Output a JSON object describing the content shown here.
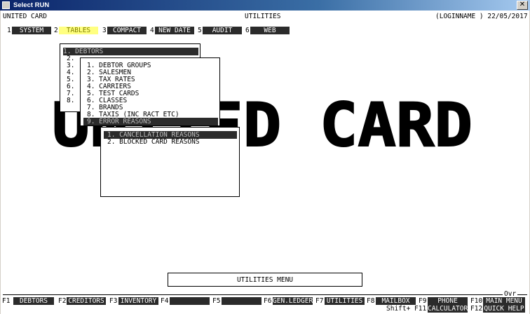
{
  "window": {
    "title": "Select RUN",
    "close_glyph": "✕"
  },
  "header": {
    "left": "UNITED CARD",
    "center": "UTILITIES",
    "right": "(LOGINNAME ) 22/05/2017"
  },
  "menubar": [
    {
      "num": "1",
      "label": "SYSTEM"
    },
    {
      "num": "2",
      "label": "TABLES",
      "active": true
    },
    {
      "num": "3",
      "label": "COMPACT"
    },
    {
      "num": "4",
      "label": "NEW DATE"
    },
    {
      "num": "5",
      "label": "AUDIT"
    },
    {
      "num": "6",
      "label": "WEB"
    }
  ],
  "banner": {
    "text": "UNITED CARD"
  },
  "menu1": {
    "items": [
      "1. DEBTORS",
      "2.",
      "3.",
      "4.",
      "5.",
      "6.",
      "7.",
      "8."
    ]
  },
  "menu2": {
    "items": [
      "1. DEBTOR GROUPS",
      "2. SALESMEN",
      "3. TAX RATES",
      "4. CARRIERS",
      "5. TEST CARDS",
      "6. CLASSES",
      "7. BRANDS",
      "8. TAXIS (INC RACT ETC)",
      "9. ERROR REASONS"
    ]
  },
  "menu3": {
    "items": [
      "1. CANCELLATION REASONS",
      "2. BLOCKED CARD REASONS"
    ]
  },
  "status": {
    "menu_label": "UTILITIES MENU",
    "ovr": "Ovr"
  },
  "fkeys": {
    "row1": [
      {
        "key": "F1",
        "label": "DEBTORS"
      },
      {
        "key": "F2",
        "label": "CREDITORS"
      },
      {
        "key": "F3",
        "label": "INVENTORY"
      },
      {
        "key": "F4",
        "label": ""
      },
      {
        "key": "F5",
        "label": ""
      },
      {
        "key": "F6",
        "label": "GEN.LEDGER"
      },
      {
        "key": "F7",
        "label": "UTILITIES"
      },
      {
        "key": "F8",
        "label": "MAILBOX"
      },
      {
        "key": "F9",
        "label": "PHONE LIST"
      },
      {
        "key": "F10",
        "label": "MAIN MENU"
      }
    ],
    "row2": [
      {
        "key": "Shift+ F11",
        "label": "CALCULATOR"
      },
      {
        "key": "F12",
        "label": "QUICK HELP"
      }
    ]
  }
}
